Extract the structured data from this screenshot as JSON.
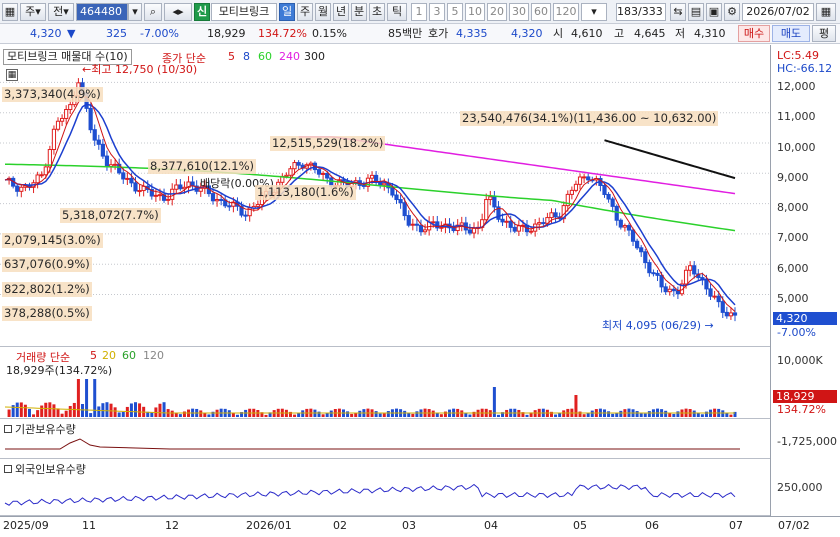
{
  "toolbar": {
    "period_label": "주",
    "range_label": "전",
    "code": "464480",
    "sin": "신",
    "stock_name": "모티브링크",
    "periods": [
      "일",
      "주",
      "월",
      "년",
      "분",
      "초",
      "틱"
    ],
    "intervals": [
      "1",
      "3",
      "5",
      "10",
      "20",
      "30",
      "60",
      "120"
    ],
    "counter": "183/333",
    "date": "2026/07/02"
  },
  "quote": {
    "price": "4,320",
    "change": "325",
    "change_pct": "-7.00%",
    "volume": "18,929",
    "volume_ratio": "134.72%",
    "turnover": "0.15%",
    "amount": "85백만",
    "bid_label": "호가",
    "bid1": "4,335",
    "bid2": "4,320",
    "open_label": "시",
    "open": "4,610",
    "high_label": "고",
    "high": "4,645",
    "low_label": "저",
    "low": "4,310",
    "buy_label": "매수",
    "sell_label": "매도",
    "eval_label": "평"
  },
  "price_panel": {
    "legend_name": "모티브링크 매물대 수(10)",
    "legend_ma": "종가 단순",
    "ma_periods": [
      "5",
      "8",
      "60",
      "240",
      "300"
    ],
    "lc": "LC:5.49",
    "hc": "HC:-66.12",
    "high_note": "최고 12,750 (10/30)",
    "low_note": "최저 4,095 (06/29)",
    "dividend_note": "배당락(0.00%)",
    "current_price": "4,320",
    "current_pct": "-7.00%",
    "volume_profile": [
      "3,373,340(4.9%)",
      "23,540,476(34.1%)(11,436.00 ~ 10,632.00)",
      "12,515,529(18.2%)",
      "8,377,610(12.1%)",
      "5,318,072(7.7%)",
      "1,113,180(1.6%)",
      "2,079,145(3.0%)",
      "637,076(0.9%)",
      "822,802(1.2%)",
      "378,288(0.5%)"
    ],
    "axis_ticks": [
      "12,000",
      "11,000",
      "10,000",
      "9,000",
      "8,000",
      "7,000",
      "6,000",
      "5,000"
    ]
  },
  "volume_panel": {
    "legend": "거래량 단순",
    "periods": [
      "5",
      "20",
      "60",
      "120"
    ],
    "note": "18,929주(134.72%)",
    "axis_tick": "10,000K",
    "current": "18,929",
    "current_pct": "134.72%"
  },
  "inst_panel": {
    "title": "기관보유수량",
    "axis_tick": "-1,725,000"
  },
  "foreign_panel": {
    "title": "외국인보유수량",
    "axis_tick": "250,000"
  },
  "x_axis": [
    "2025/09",
    "11",
    "12",
    "2026/01",
    "02",
    "03",
    "04",
    "05",
    "06",
    "07",
    "07/02"
  ],
  "colors": {
    "up": "#e02020",
    "down": "#1f4fd0",
    "ma5": "#d01515",
    "ma8": "#1c3fcf",
    "ma60": "#2bd12b",
    "ma240": "#e11ee1",
    "ma300": "#111111"
  }
}
